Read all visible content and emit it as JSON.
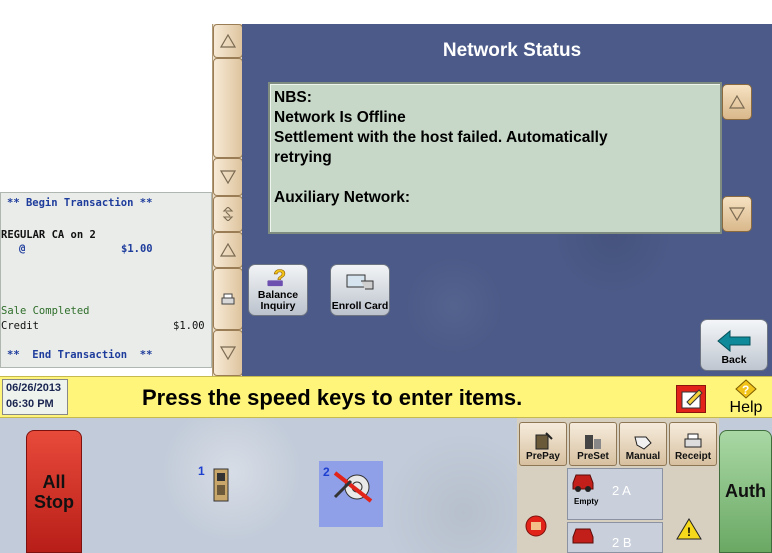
{
  "network_status": {
    "title": "Network Status",
    "lines": [
      "NBS:",
      "Network Is Offline",
      "Settlement with the host failed. Automatically",
      "retrying",
      "",
      "Auxiliary Network:"
    ]
  },
  "receipt": {
    "begin": "** Begin Transaction **",
    "item": "REGULAR CA on 2",
    "at": "@",
    "item_price": "$1.00",
    "sale_completed": "Sale Completed",
    "tender": "Credit",
    "tender_amount": "$1.00",
    "end": "**  End Transaction  **"
  },
  "cards": {
    "balance_inquiry": [
      "Balance",
      "Inquiry"
    ],
    "enroll_card": "Enroll Card"
  },
  "back_label": "Back",
  "status_bar": {
    "date": "06/26/2013",
    "time": "06:30 PM",
    "prompt": "Press the speed keys to enter items.",
    "help_label": "Help"
  },
  "bottom": {
    "all_stop": [
      "All",
      "Stop"
    ],
    "auth": "Auth",
    "pump1_number": "1",
    "pump2_number": "2",
    "fn_buttons": [
      "PrePay",
      "PreSet",
      "Manual",
      "Receipt"
    ],
    "fuel_empty": "Empty",
    "pos_2a": "2 A",
    "pos_2b": "2 B"
  },
  "colors": {
    "panel_blue": "#4b5a88",
    "message_green": "#c7d8c8",
    "status_yellow": "#fff57a",
    "stop_red": "#c8261d",
    "auth_green": "#86c07f",
    "selected_pump": "#8f9fe8"
  }
}
